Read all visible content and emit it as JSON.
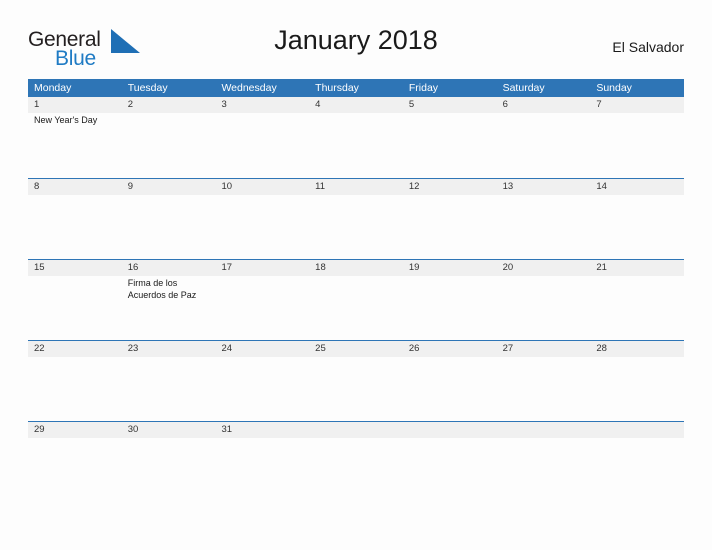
{
  "logo": {
    "word_one": "General",
    "word_two": "Blue",
    "flag_icon": "blue-flag-triangle-icon",
    "accent_color": "#1f7bc4"
  },
  "header": {
    "title": "January 2018",
    "locale": "El Salvador"
  },
  "colors": {
    "header_blue": "#2e75b6",
    "row_band_gray": "#f0f0f0",
    "page_background": "#fdfdfd",
    "text_dark": "#1a1a1a"
  },
  "calendar": {
    "month": "January",
    "year": "2018",
    "week_start": "Monday",
    "weekdays": [
      "Monday",
      "Tuesday",
      "Wednesday",
      "Thursday",
      "Friday",
      "Saturday",
      "Sunday"
    ],
    "weeks": [
      {
        "days": [
          {
            "number": "1",
            "events": [
              "New Year's Day"
            ]
          },
          {
            "number": "2",
            "events": []
          },
          {
            "number": "3",
            "events": []
          },
          {
            "number": "4",
            "events": []
          },
          {
            "number": "5",
            "events": []
          },
          {
            "number": "6",
            "events": []
          },
          {
            "number": "7",
            "events": []
          }
        ]
      },
      {
        "days": [
          {
            "number": "8",
            "events": []
          },
          {
            "number": "9",
            "events": []
          },
          {
            "number": "10",
            "events": []
          },
          {
            "number": "11",
            "events": []
          },
          {
            "number": "12",
            "events": []
          },
          {
            "number": "13",
            "events": []
          },
          {
            "number": "14",
            "events": []
          }
        ]
      },
      {
        "days": [
          {
            "number": "15",
            "events": []
          },
          {
            "number": "16",
            "events": [
              "Firma de los Acuerdos de Paz"
            ]
          },
          {
            "number": "17",
            "events": []
          },
          {
            "number": "18",
            "events": []
          },
          {
            "number": "19",
            "events": []
          },
          {
            "number": "20",
            "events": []
          },
          {
            "number": "21",
            "events": []
          }
        ]
      },
      {
        "days": [
          {
            "number": "22",
            "events": []
          },
          {
            "number": "23",
            "events": []
          },
          {
            "number": "24",
            "events": []
          },
          {
            "number": "25",
            "events": []
          },
          {
            "number": "26",
            "events": []
          },
          {
            "number": "27",
            "events": []
          },
          {
            "number": "28",
            "events": []
          }
        ]
      },
      {
        "days": [
          {
            "number": "29",
            "events": []
          },
          {
            "number": "30",
            "events": []
          },
          {
            "number": "31",
            "events": []
          },
          {
            "number": "",
            "events": []
          },
          {
            "number": "",
            "events": []
          },
          {
            "number": "",
            "events": []
          },
          {
            "number": "",
            "events": []
          }
        ]
      }
    ]
  }
}
